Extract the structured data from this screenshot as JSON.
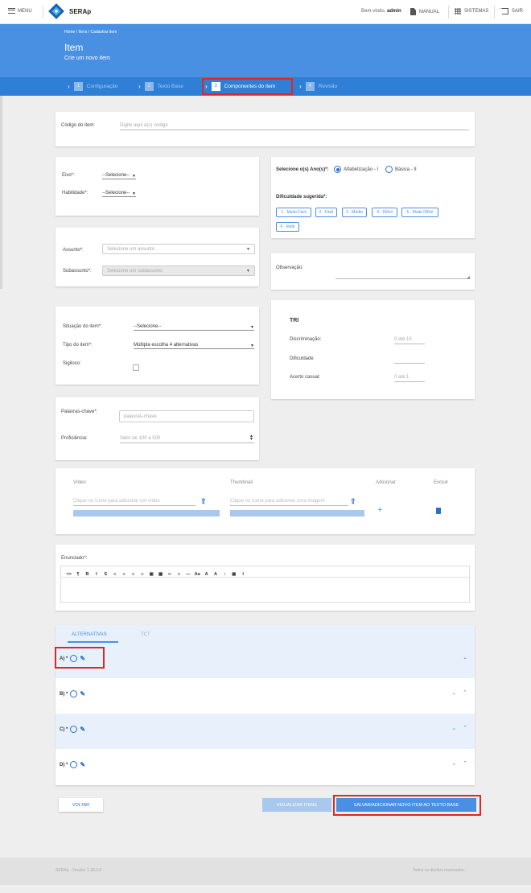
{
  "topbar": {
    "menu_label": "MENU",
    "app_name": "SERAp",
    "greeting_prefix": "Bem-vindo,",
    "user": "admin",
    "manual_label": "MANUAL",
    "systems_label": "SISTEMAS",
    "exit_label": "SAIR"
  },
  "header": {
    "breadcrumb": "Home / Itens / Cadastrar item",
    "title": "Item",
    "subtitle": "Crie um novo item"
  },
  "steps": [
    {
      "num": "1",
      "label": "Configuração"
    },
    {
      "num": "2",
      "label": "Texto Base"
    },
    {
      "num": "3",
      "label": "Componentes do item"
    },
    {
      "num": "4",
      "label": "Revisão"
    }
  ],
  "codigo": {
    "label": "Código do item:",
    "placeholder": "Digite aqui a(s) código"
  },
  "eixo": {
    "label": "Eixo*:",
    "value": "--Selecione--"
  },
  "habilidade": {
    "label": "Habilidade*:",
    "value": "--Selecione--"
  },
  "anos": {
    "label": "Selecione o(s) Ano(s)*:",
    "options": [
      {
        "label": "Alfabetização - I",
        "checked": true
      },
      {
        "label": "Básica - II",
        "checked": false
      }
    ]
  },
  "dificuldade": {
    "label": "Dificuldade sugerida*:",
    "chips": [
      "1 - Muito Fácil",
      "2 - Fácil",
      "3 - Médio",
      "4 - Difícil",
      "5 - Muito Difícil",
      "6 - teste"
    ]
  },
  "assunto": {
    "label": "Assunto*:",
    "placeholder": "Selecione um assunto"
  },
  "subassunto": {
    "label": "Subassunto*:",
    "placeholder": "Selecione um subassunto"
  },
  "observacao": {
    "label": "Observação:"
  },
  "situacao": {
    "label": "Situação do item*:",
    "value": "--Selecione--"
  },
  "tipo": {
    "label": "Tipo do item*:",
    "value": "Múltipla escolha 4 alternativas"
  },
  "sigiloso": {
    "label": "Sigiloso:"
  },
  "tri": {
    "title": "TRI",
    "discriminacao": {
      "label": "Discriminação:",
      "placeholder": "0 até 10"
    },
    "dificuldade": {
      "label": "Dificuldade"
    },
    "acerto": {
      "label": "Acerto casual:",
      "placeholder": "0 até 1"
    }
  },
  "palavras": {
    "label": "Palavras-chave*:",
    "placeholder": "palavras-chave"
  },
  "proficiencia": {
    "label": "Proficiência:",
    "placeholder": "Valor de 100 a 500"
  },
  "media": {
    "headers": {
      "video": "Vídeo",
      "thumbnail": "Thumbnail",
      "add": "Adicionar",
      "delete": "Excluir"
    },
    "video_placeholder": "Clique no ícone para adicionar um vídeo",
    "thumb_placeholder": "Clique no ícone para adicionar uma imagem"
  },
  "enunciado": {
    "label": "Enunciado*:",
    "toolbar": [
      "<>",
      "¶",
      "B",
      "I",
      "S",
      "≡",
      "≡",
      "≡",
      "≡",
      "▣",
      "▦",
      "∞",
      "≡",
      "—",
      "Aa",
      "A",
      "A",
      "↕",
      "▣",
      "I"
    ]
  },
  "tabs": {
    "alternativas": "ALTERNATIVAS",
    "tct": "TCT"
  },
  "alternatives": [
    {
      "label": "A) *",
      "chevrons": "⌄"
    },
    {
      "label": "B) *",
      "chevrons": "⌄ ⌃"
    },
    {
      "label": "C) *",
      "chevrons": "⌄ ⌃"
    },
    {
      "label": "D) *",
      "chevrons": "⌄ ⌃"
    }
  ],
  "buttons": {
    "voltar": "VOLTAR",
    "visualizar": "VISUALIZAR ITENS",
    "salvar": "SALVAR/ADICIONAR NOVO ITEM AO TEXTO BASE"
  },
  "footer": {
    "version": "SERAp - Versão: 1.35.0.0",
    "rights": "Todos os direitos reservados."
  }
}
